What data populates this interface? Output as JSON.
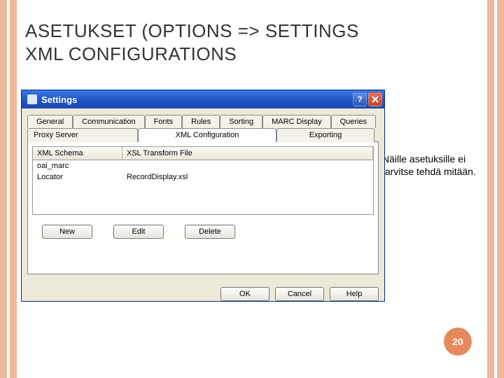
{
  "slide": {
    "heading_line1": "ASETUKSET (OPTIONS => SETTINGS",
    "heading_line2": "XML CONFIGURATIONS",
    "annotation": "Näille asetuksille ei tarvitse tehdä mitään.",
    "page_number": "20"
  },
  "dialog": {
    "title": "Settings",
    "tabs_row1": [
      "General",
      "Communication",
      "Fonts",
      "Rules",
      "Sorting",
      "MARC Display",
      "Queries"
    ],
    "tabs_row2": [
      "Proxy Server",
      "XML Configuration",
      "Exporting"
    ],
    "active_tab": "XML Configuration",
    "list": {
      "col1": "XML Schema",
      "col2": "XSL Transform File",
      "rows": [
        {
          "schema": "oai_marc",
          "xsl": ""
        },
        {
          "schema": "Locator",
          "xsl": "RecordDisplay.xsl"
        }
      ]
    },
    "buttons": {
      "new": "New",
      "edit": "Edit",
      "delete": "Delete"
    },
    "dlg_buttons": {
      "ok": "OK",
      "cancel": "Cancel",
      "help": "Help"
    }
  }
}
